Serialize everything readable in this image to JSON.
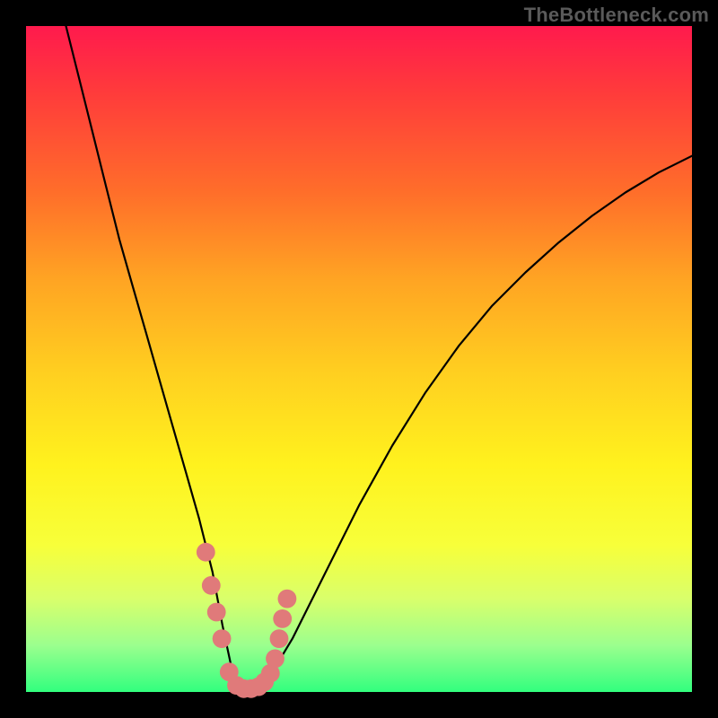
{
  "watermark": "TheBottleneck.com",
  "chart_data": {
    "type": "line",
    "title": "",
    "xlabel": "",
    "ylabel": "",
    "xlim": [
      0,
      100
    ],
    "ylim": [
      0,
      100
    ],
    "grid": false,
    "legend": false,
    "background": {
      "type": "vertical-gradient",
      "stops": [
        {
          "pos": 0,
          "color": "#ff1a4d"
        },
        {
          "pos": 25,
          "color": "#ff6e2a"
        },
        {
          "pos": 50,
          "color": "#ffcf20"
        },
        {
          "pos": 75,
          "color": "#fff21e"
        },
        {
          "pos": 100,
          "color": "#32ff7e"
        }
      ]
    },
    "series": [
      {
        "name": "bottleneck-curve",
        "x": [
          6,
          8,
          10,
          12,
          14,
          16,
          18,
          20,
          22,
          24,
          26,
          28,
          29.5,
          31,
          33,
          35,
          37,
          40,
          45,
          50,
          55,
          60,
          65,
          70,
          75,
          80,
          85,
          90,
          95,
          100
        ],
        "y": [
          100,
          92,
          84,
          76,
          68,
          61,
          54,
          47,
          40,
          33,
          26,
          18,
          10,
          3,
          0,
          0,
          3,
          8,
          18,
          28,
          37,
          45,
          52,
          58,
          63,
          67.5,
          71.5,
          75,
          78,
          80.5
        ]
      }
    ],
    "markers": {
      "name": "highlight-dots",
      "color": "#e07a7a",
      "radius": 1.4,
      "x": [
        27.0,
        27.8,
        28.6,
        29.4,
        30.5,
        31.6,
        32.7,
        33.8,
        34.9,
        35.8,
        36.7,
        37.4,
        38.0,
        38.5,
        39.2
      ],
      "y": [
        21.0,
        16.0,
        12.0,
        8.0,
        3.0,
        1.0,
        0.5,
        0.5,
        0.8,
        1.5,
        2.8,
        5.0,
        8.0,
        11.0,
        14.0
      ]
    }
  }
}
